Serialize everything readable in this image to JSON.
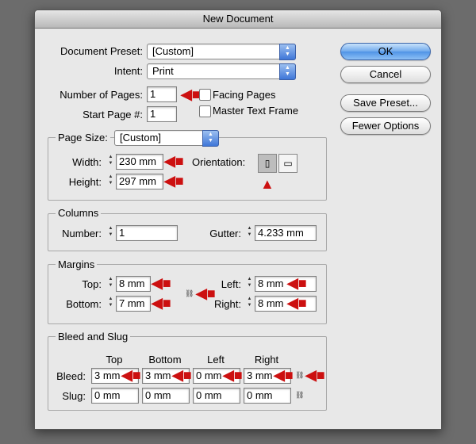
{
  "window": {
    "title": "New Document"
  },
  "document_preset": {
    "label": "Document Preset:",
    "value": "[Custom]"
  },
  "intent": {
    "label": "Intent:",
    "value": "Print"
  },
  "pages": {
    "number_label": "Number of Pages:",
    "number_value": "1",
    "start_label": "Start Page #:",
    "start_value": "1",
    "facing_label": "Facing Pages",
    "master_label": "Master Text Frame"
  },
  "buttons": {
    "ok": "OK",
    "cancel": "Cancel",
    "save_preset": "Save Preset...",
    "fewer_options": "Fewer Options"
  },
  "page_size": {
    "label": "Page Size:",
    "value": "[Custom]",
    "width_label": "Width:",
    "width_value": "230 mm",
    "height_label": "Height:",
    "height_value": "297 mm",
    "orientation_label": "Orientation:"
  },
  "columns": {
    "title": "Columns",
    "number_label": "Number:",
    "number_value": "1",
    "gutter_label": "Gutter:",
    "gutter_value": "4.233 mm"
  },
  "margins": {
    "title": "Margins",
    "top_label": "Top:",
    "top_value": "8 mm",
    "bottom_label": "Bottom:",
    "bottom_value": "7 mm",
    "left_label": "Left:",
    "left_value": "8 mm",
    "right_label": "Right:",
    "right_value": "8 mm"
  },
  "bleed_slug": {
    "title": "Bleed and Slug",
    "headers": [
      "Top",
      "Bottom",
      "Left",
      "Right"
    ],
    "bleed_label": "Bleed:",
    "bleed_values": [
      "3 mm",
      "3 mm",
      "0 mm",
      "3 mm"
    ],
    "slug_label": "Slug:",
    "slug_values": [
      "0 mm",
      "0 mm",
      "0 mm",
      "0 mm"
    ]
  },
  "colors": {
    "annotation_arrow": "#cc1010",
    "primary_button": "#4f93e6"
  }
}
